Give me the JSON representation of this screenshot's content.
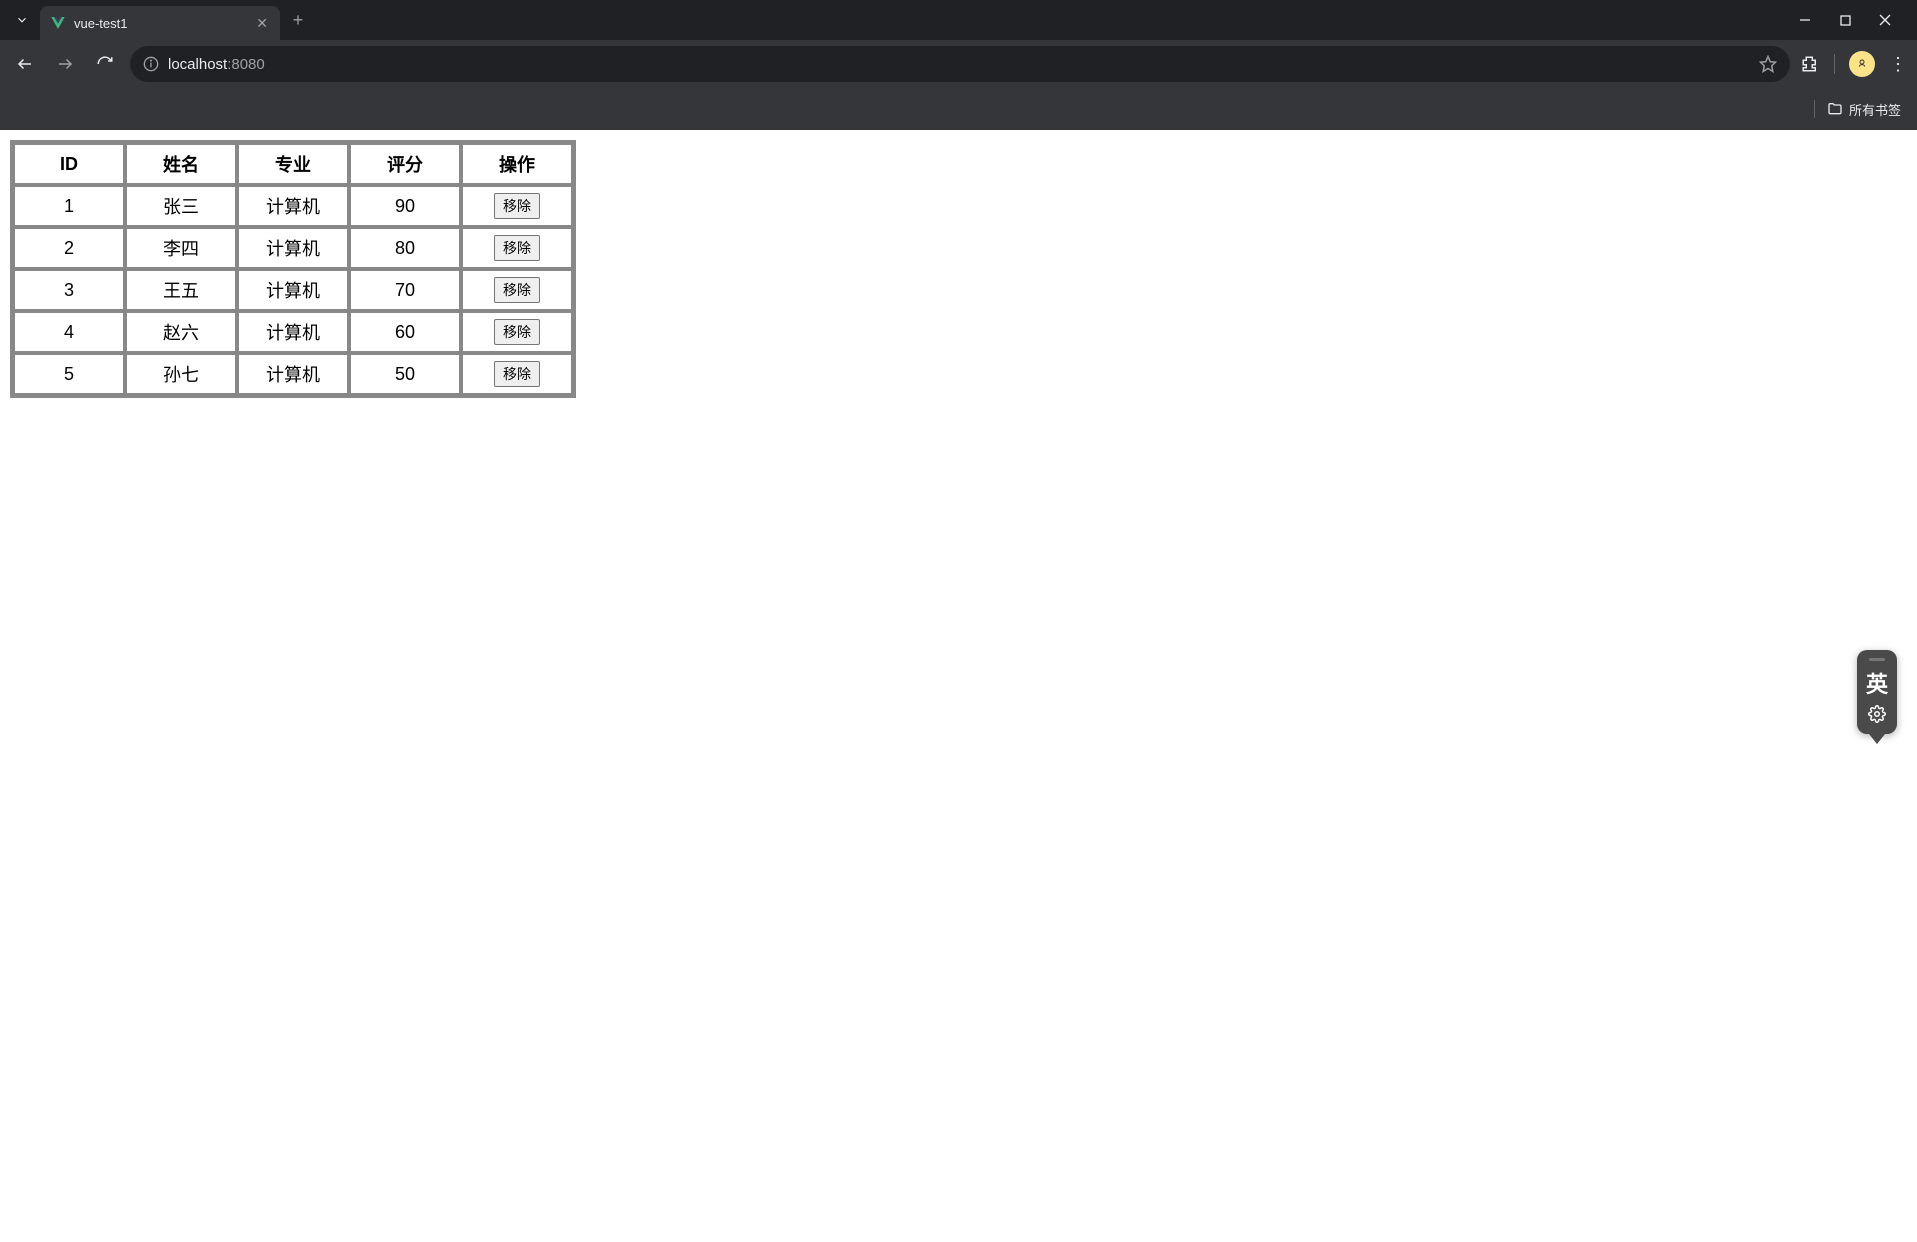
{
  "browser": {
    "tab_title": "vue-test1",
    "url_host": "localhost",
    "url_port": ":8080",
    "bookmarks_label": "所有书签"
  },
  "ime": {
    "mode_char": "英"
  },
  "table": {
    "headers": {
      "id": "ID",
      "name": "姓名",
      "major": "专业",
      "score": "评分",
      "action": "操作"
    },
    "remove_label": "移除",
    "rows": [
      {
        "id": "1",
        "name": "张三",
        "major": "计算机",
        "score": "90"
      },
      {
        "id": "2",
        "name": "李四",
        "major": "计算机",
        "score": "80"
      },
      {
        "id": "3",
        "name": "王五",
        "major": "计算机",
        "score": "70"
      },
      {
        "id": "4",
        "name": "赵六",
        "major": "计算机",
        "score": "60"
      },
      {
        "id": "5",
        "name": "孙七",
        "major": "计算机",
        "score": "50"
      }
    ]
  }
}
